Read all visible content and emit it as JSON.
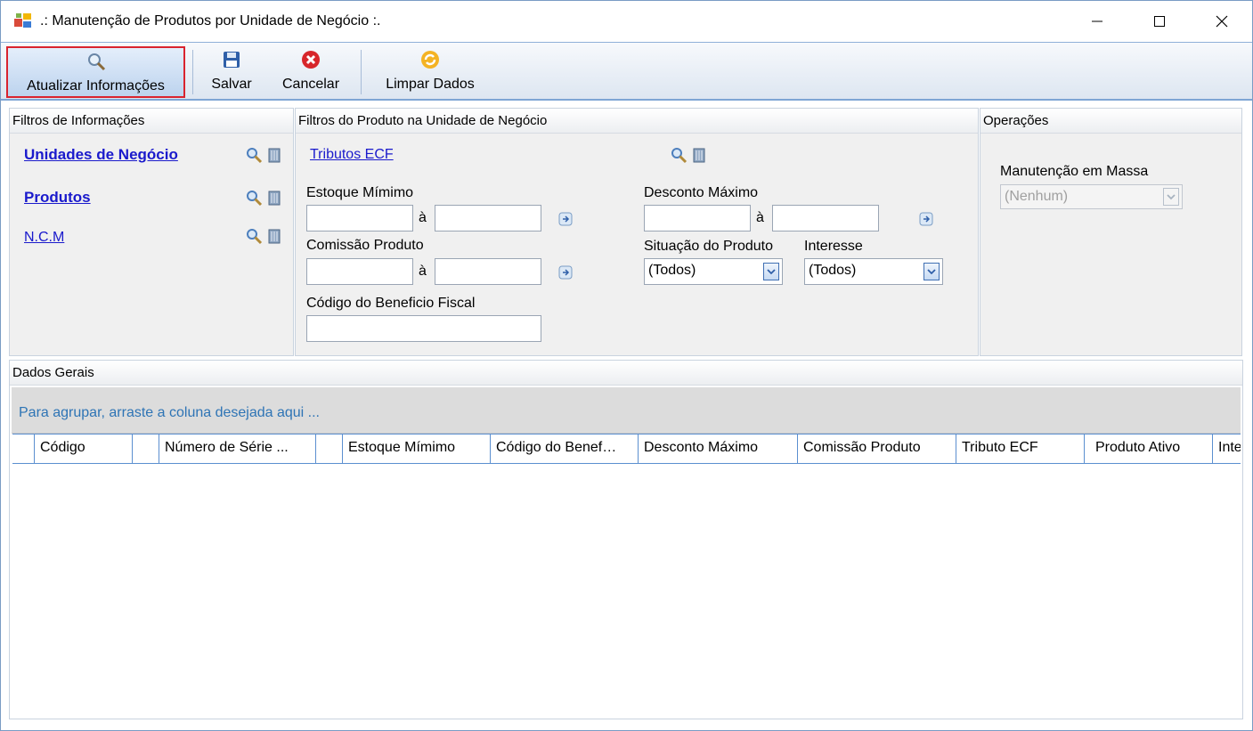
{
  "window": {
    "title": ".: Manutenção de Produtos por Unidade de Negócio :.",
    "minimize_glyph": "—",
    "maximize_glyph": "☐",
    "close_glyph": "✕"
  },
  "toolbar": {
    "refresh_label": "Atualizar Informações",
    "save_label": "Salvar",
    "cancel_label": "Cancelar",
    "clear_label": "Limpar Dados"
  },
  "filtros_info": {
    "header": "Filtros de Informações",
    "links": [
      "Unidades de Negócio",
      "Produtos",
      "N.C.M"
    ]
  },
  "filtros_produto": {
    "header": "Filtros do Produto na Unidade de Negócio",
    "tributos_link": "Tributos ECF",
    "estoque_label": "Estoque Mímimo",
    "desconto_label": "Desconto Máximo",
    "comissao_label": "Comissão Produto",
    "situacao_label": "Situação do Produto",
    "interesse_label": "Interesse",
    "beneficio_label": "Código do Beneficio Fiscal",
    "range_sep": "à",
    "situacao_value": "(Todos)",
    "interesse_value": "(Todos)"
  },
  "operacoes": {
    "header": "Operações",
    "massa_label": "Manutenção em Massa",
    "massa_value": "(Nenhum)"
  },
  "dados_gerais": {
    "header": "Dados Gerais",
    "group_hint": "Para agrupar, arraste a coluna desejada aqui ...",
    "columns": [
      "",
      "Código",
      "",
      "Número de Série ...",
      "",
      "Estoque Mímimo",
      "Código do Benef…",
      "Desconto Máximo",
      "Comissão Produto",
      "Tributo ECF",
      "Produto Ativo",
      "Inte"
    ]
  },
  "colors": {
    "link": "#1a1acc",
    "hint": "#2e74b5",
    "highlight_border": "#d9232e",
    "grid_line": "#5b8fd0"
  }
}
